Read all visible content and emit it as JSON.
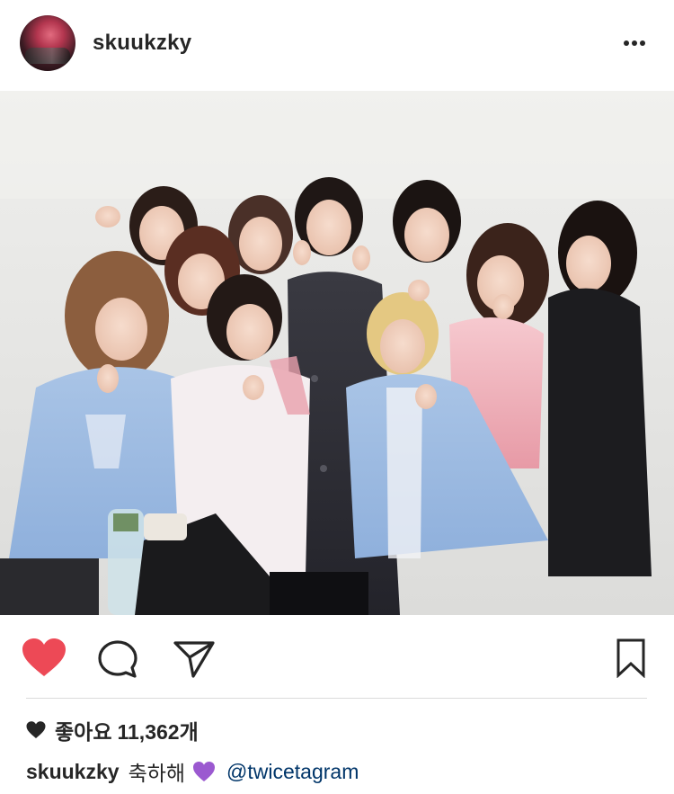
{
  "post": {
    "username": "skuukzky",
    "avatar_icon": "profile-avatar",
    "more_icon": "more-options-icon",
    "photo_alt": ""
  },
  "actions": {
    "like_icon": "heart-filled-icon",
    "like_color": "#ed4956",
    "comment_icon": "comment-icon",
    "share_icon": "send-icon",
    "save_icon": "bookmark-icon"
  },
  "likes": {
    "label": "좋아요",
    "count": "11,362개"
  },
  "caption": {
    "username": "skuukzky",
    "text": "축하해",
    "emoji": "purple-heart",
    "emoji_color": "#9b59d0",
    "mention": "@twicetagram"
  }
}
